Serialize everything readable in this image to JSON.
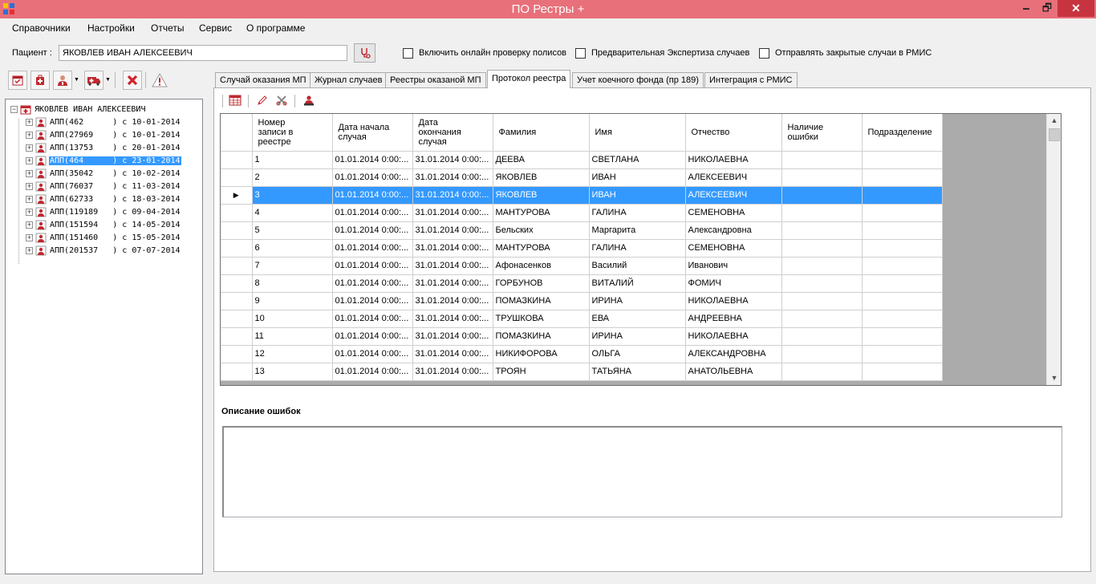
{
  "window": {
    "title": "ПО Рестры +",
    "minimize": "🗕",
    "maximize": "🗗",
    "close": "✕"
  },
  "menu": [
    "Справочники",
    "Настройки",
    "Отчеты",
    "Сервис",
    "О программе"
  ],
  "patient": {
    "label": "Пациент :",
    "value": "ЯКОВЛЕВ ИВАН АЛЕКСЕЕВИЧ"
  },
  "options": [
    {
      "label": "Включить онлайн проверку полисов",
      "checked": false
    },
    {
      "label": "Предварительная Экспертиза случаев",
      "checked": false
    },
    {
      "label": "Отправлять закрытые случаи в РМИС",
      "checked": false
    }
  ],
  "tree": {
    "root": "ЯКОВЛЕВ ИВАН АЛЕКСЕЕВИЧ",
    "nodes": [
      "АПП(462      ) с 10-01-2014",
      "АПП(27969    ) с 10-01-2014",
      "АПП(13753    ) с 20-01-2014",
      "АПП(464      ) с 23-01-2014",
      "АПП(35042    ) с 10-02-2014",
      "АПП(76037    ) с 11-03-2014",
      "АПП(62733    ) с 18-03-2014",
      "АПП(119189   ) с 09-04-2014",
      "АПП(151594   ) с 14-05-2014",
      "АПП(151460   ) с 15-05-2014",
      "АПП(201537   ) с 07-07-2014"
    ],
    "selected_index": 3
  },
  "tabs": [
    "Случай оказания МП",
    "Журнал случаев",
    "Реестры оказаной МП",
    "Протокол реестра",
    "Учет коечного фонда (пр 189)",
    "Интеграция с РМИС"
  ],
  "active_tab": "Протокол реестра",
  "grid": {
    "columns": [
      "Номер\nзаписи в\nреестре",
      "Дата начала\nслучая",
      "Дата\nокончания\nслучая",
      "Фамилия",
      "Имя",
      "Отчество",
      "Наличие\nошибки",
      "Подразделение"
    ],
    "rows": [
      [
        "1",
        "01.01.2014 0:00:...",
        "31.01.2014 0:00:...",
        "ДЕЕВА",
        "СВЕТЛАНА",
        "НИКОЛАЕВНА",
        "",
        ""
      ],
      [
        "2",
        "01.01.2014 0:00:...",
        "31.01.2014 0:00:...",
        "ЯКОВЛЕВ",
        "ИВАН",
        "АЛЕКСЕЕВИЧ",
        "",
        ""
      ],
      [
        "3",
        "01.01.2014 0:00:...",
        "31.01.2014 0:00:...",
        "ЯКОВЛЕВ",
        "ИВАН",
        "АЛЕКСЕЕВИЧ",
        "",
        ""
      ],
      [
        "4",
        "01.01.2014 0:00:...",
        "31.01.2014 0:00:...",
        "МАНТУРОВА",
        "ГАЛИНА",
        "СЕМЕНОВНА",
        "",
        ""
      ],
      [
        "5",
        "01.01.2014 0:00:...",
        "31.01.2014 0:00:...",
        "Бельских",
        "Маргарита",
        "Александровна",
        "",
        ""
      ],
      [
        "6",
        "01.01.2014 0:00:...",
        "31.01.2014 0:00:...",
        "МАНТУРОВА",
        "ГАЛИНА",
        "СЕМЕНОВНА",
        "",
        ""
      ],
      [
        "7",
        "01.01.2014 0:00:...",
        "31.01.2014 0:00:...",
        "Афонасенков",
        "Василий",
        "Иванович",
        "",
        ""
      ],
      [
        "8",
        "01.01.2014 0:00:...",
        "31.01.2014 0:00:...",
        "ГОРБУНОВ",
        "ВИТАЛИЙ",
        "ФОМИЧ",
        "",
        ""
      ],
      [
        "9",
        "01.01.2014 0:00:...",
        "31.01.2014 0:00:...",
        "ПОМАЗКИНА",
        "ИРИНА",
        "НИКОЛАЕВНА",
        "",
        ""
      ],
      [
        "10",
        "01.01.2014 0:00:...",
        "31.01.2014 0:00:...",
        "ТРУШКОВА",
        "ЕВА",
        "АНДРЕЕВНА",
        "",
        ""
      ],
      [
        "11",
        "01.01.2014 0:00:...",
        "31.01.2014 0:00:...",
        "ПОМАЗКИНА",
        "ИРИНА",
        "НИКОЛАЕВНА",
        "",
        ""
      ],
      [
        "12",
        "01.01.2014 0:00:...",
        "31.01.2014 0:00:...",
        "НИКИФОРОВА",
        "ОЛЬГА",
        "АЛЕКСАНДРОВНА",
        "",
        ""
      ],
      [
        "13",
        "01.01.2014 0:00:...",
        "31.01.2014 0:00:...",
        "ТРОЯН",
        "ТАТЬЯНА",
        "АНАТОЛЬЕВНА",
        "",
        ""
      ]
    ],
    "selected_row": 2,
    "current_row_marker": "▶"
  },
  "errors": {
    "label": "Описание ошибок",
    "text": ""
  },
  "colors": {
    "titlebar": "#e8707a",
    "selection": "#3399ff",
    "close": "#c7333f"
  }
}
